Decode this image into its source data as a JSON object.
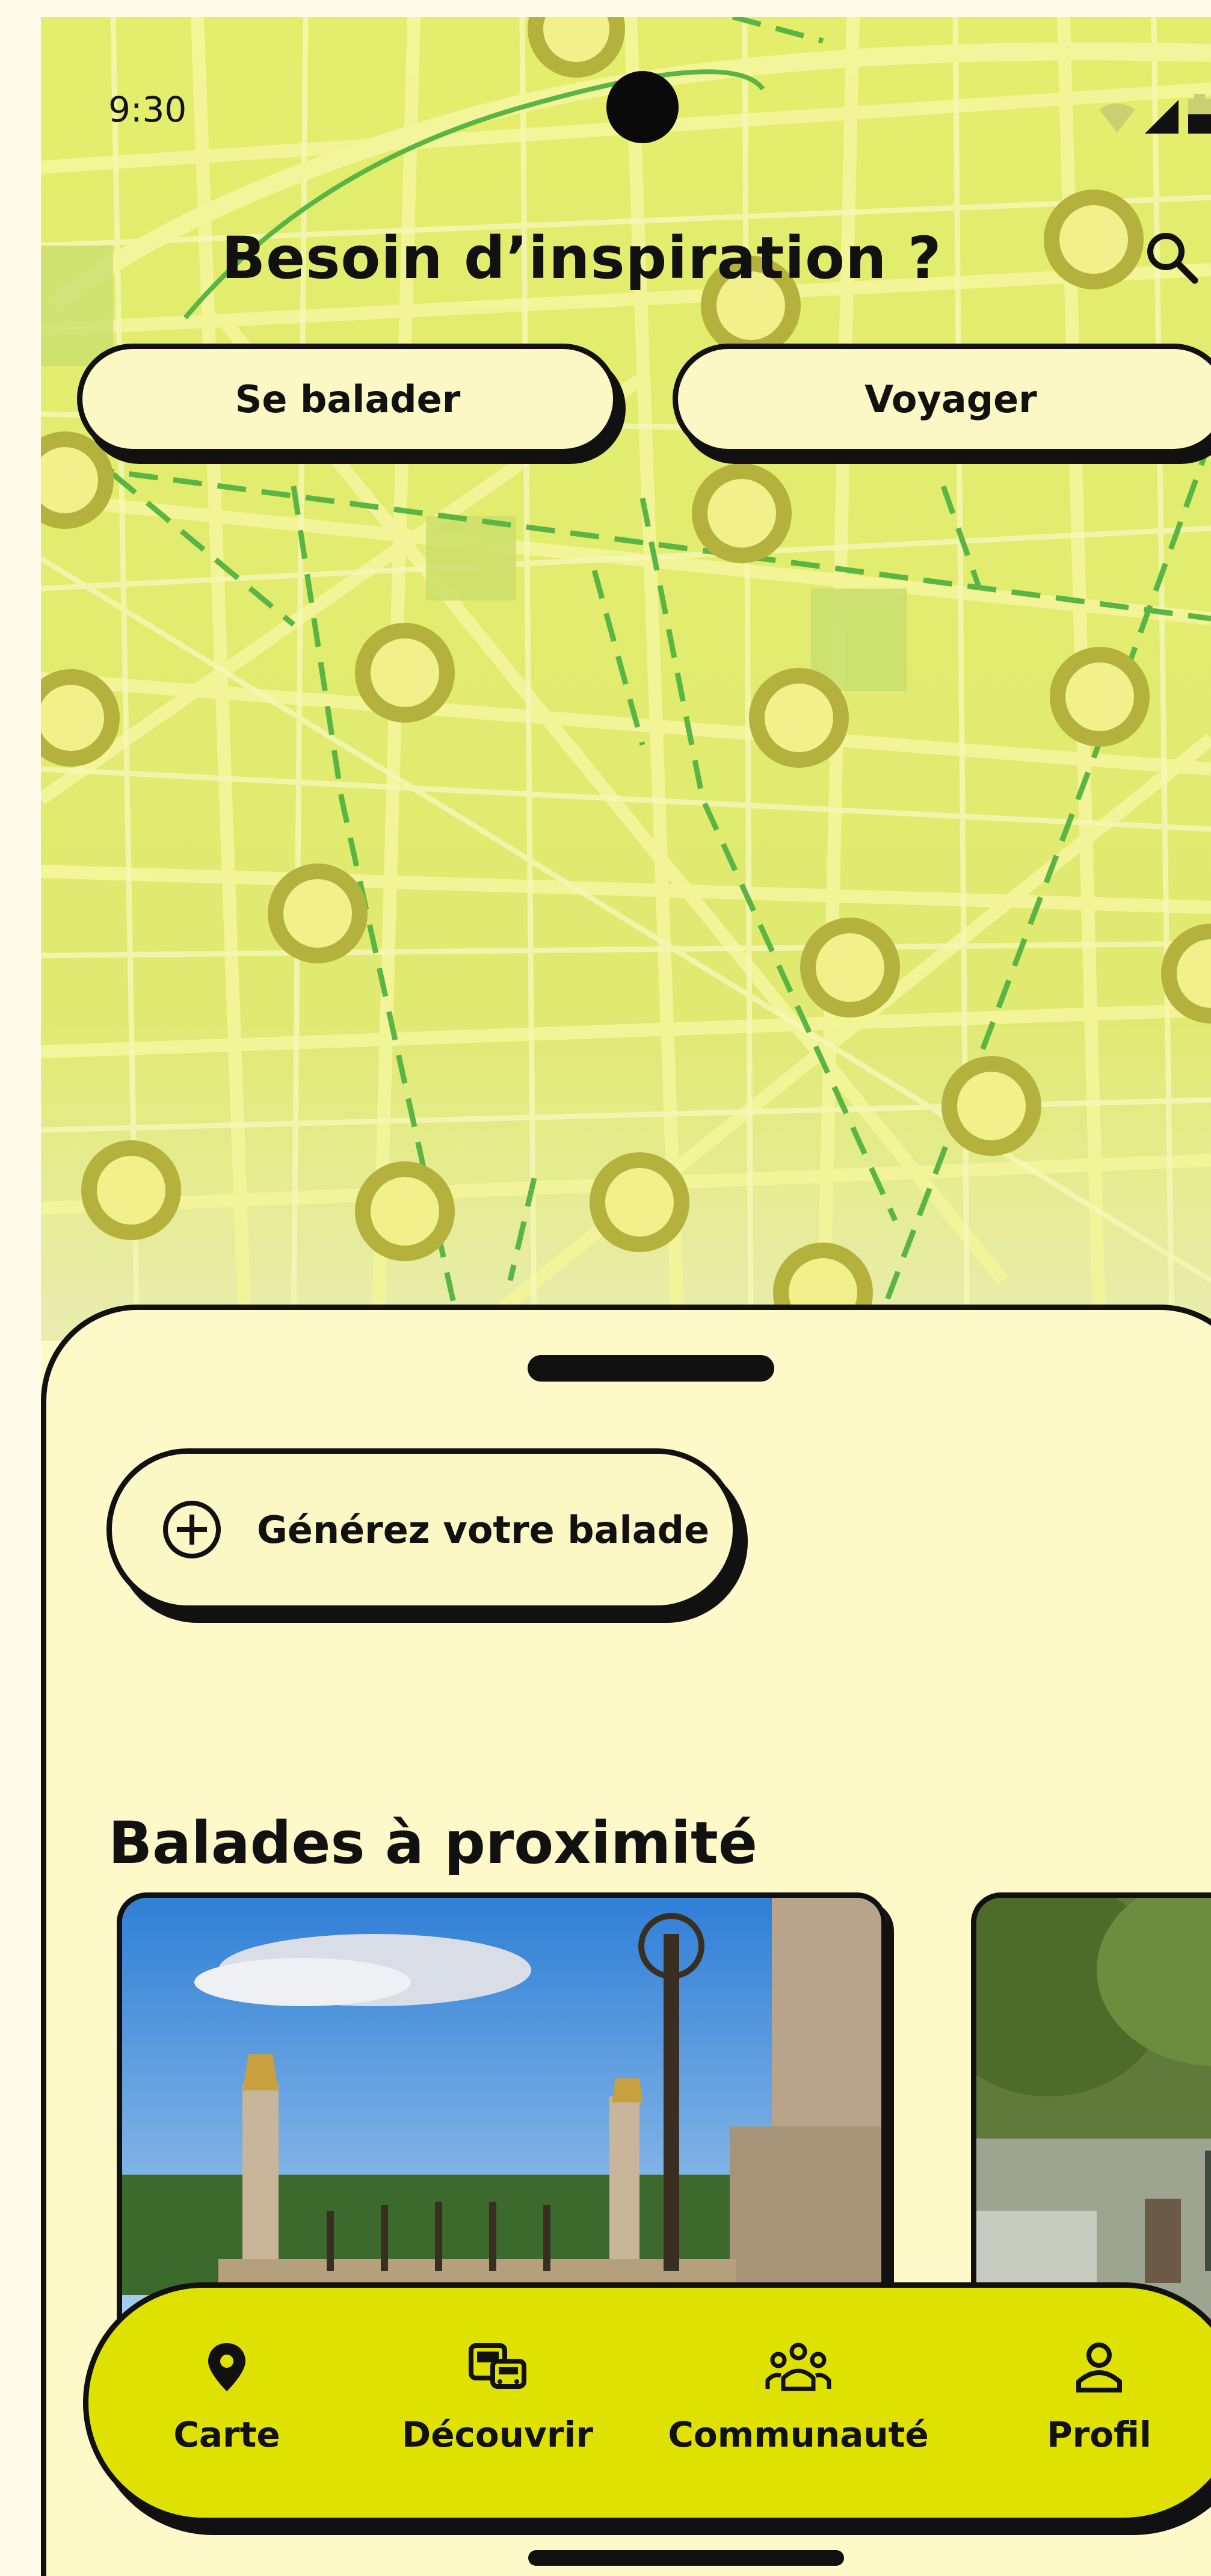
{
  "status": {
    "time": "9:30"
  },
  "header": {
    "title": "Besoin d’inspiration ?"
  },
  "top_buttons": {
    "walk": "Se balader",
    "travel": "Voyager"
  },
  "sheet": {
    "generate_label": "Générez votre balade",
    "nearby_title": "Balades à proximité"
  },
  "nav": [
    {
      "label": "Carte",
      "icon": "map-pin-icon"
    },
    {
      "label": "Découvrir",
      "icon": "bus-icon"
    },
    {
      "label": "Communauté",
      "icon": "community-icon"
    },
    {
      "label": "Profil",
      "icon": "user-icon"
    }
  ],
  "colors": {
    "map": "#e2ec6e",
    "accent": "#dfe200",
    "sheet": "#fdf9c8",
    "route": "#5ab545",
    "marker": "#b4b23c"
  }
}
